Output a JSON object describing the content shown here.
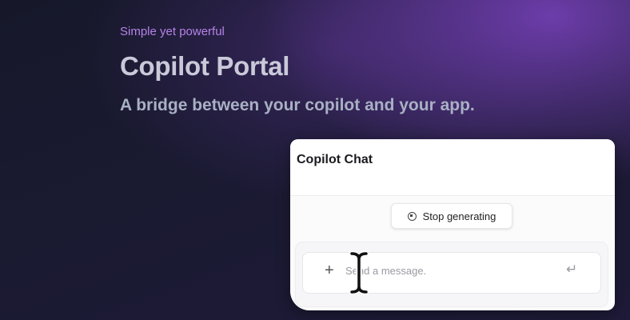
{
  "hero": {
    "tagline": "Simple yet powerful",
    "title": "Copilot Portal",
    "subtitle": "A bridge between your copilot and your app."
  },
  "chat": {
    "title": "Copilot Chat",
    "stop_button_label": "Stop generating",
    "input": {
      "value": "",
      "placeholder": "Send a message."
    },
    "add_icon": "plus-icon",
    "send_icon": "return-icon"
  },
  "cursor": "text-cursor",
  "colors": {
    "accent": "#b583e6",
    "title": "#c9c9d9",
    "subtitle": "#a9b0c4",
    "background": "#1a1a31",
    "glow": "#7a42be"
  }
}
